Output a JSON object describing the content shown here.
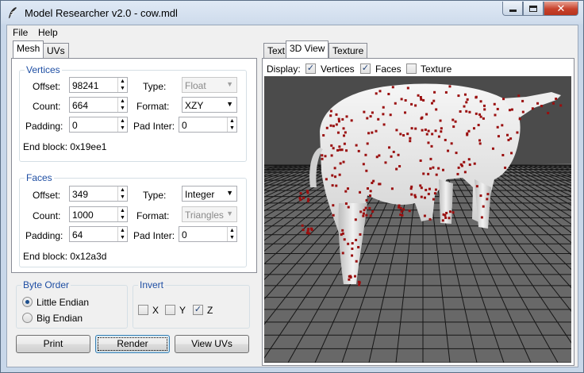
{
  "window": {
    "title": "Model Researcher v2.0 - cow.mdl"
  },
  "icons": {
    "app": "feather-icon",
    "minimize": "minimize-icon",
    "maximize": "maximize-icon",
    "close": "close-icon"
  },
  "menu": {
    "file": "File",
    "help": "Help"
  },
  "left_tabs": {
    "mesh": "Mesh",
    "uvs": "UVs"
  },
  "right_tabs": {
    "text": "Text",
    "view3d": "3D View",
    "texture": "Texture"
  },
  "vertices": {
    "group_label": "Vertices",
    "offset_label": "Offset:",
    "offset_value": "98241",
    "type_label": "Type:",
    "type_value": "Float",
    "count_label": "Count:",
    "count_value": "664",
    "format_label": "Format:",
    "format_value": "XZY",
    "padding_label": "Padding:",
    "padding_value": "0",
    "padinter_label": "Pad Inter:",
    "padinter_value": "0",
    "end_block": "End block: 0x19ee1"
  },
  "faces": {
    "group_label": "Faces",
    "offset_label": "Offset:",
    "offset_value": "349",
    "type_label": "Type:",
    "type_value": "Integer",
    "count_label": "Count:",
    "count_value": "1000",
    "format_label": "Format:",
    "format_value": "Triangles",
    "padding_label": "Padding:",
    "padding_value": "64",
    "padinter_label": "Pad Inter:",
    "padinter_value": "0",
    "end_block": "End block: 0x12a3d"
  },
  "byte_order": {
    "group_label": "Byte Order",
    "little": "Little Endian",
    "big": "Big Endian",
    "selected": "Little Endian"
  },
  "invert": {
    "group_label": "Invert",
    "x": "X",
    "y": "Y",
    "z": "Z",
    "x_checked": false,
    "y_checked": false,
    "z_checked": true
  },
  "buttons": {
    "print": "Print",
    "render": "Render",
    "view_uvs": "View UVs"
  },
  "display": {
    "label": "Display:",
    "vertices": "Vertices",
    "vertices_checked": true,
    "faces": "Faces",
    "faces_checked": true,
    "texture": "Texture",
    "texture_checked": false
  },
  "scene": {
    "background": "#4b4b4b",
    "floor_grid": "#111111",
    "model_color": "#e6e6e6",
    "vertex_color": "#a01010"
  }
}
